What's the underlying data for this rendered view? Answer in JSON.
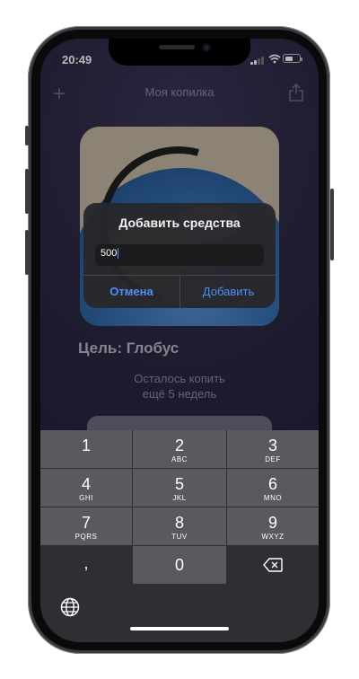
{
  "status_bar": {
    "time": "20:49"
  },
  "nav": {
    "title": "Моя копилка",
    "add_icon": "plus-icon",
    "share_icon": "share-icon"
  },
  "main": {
    "goal": "Цель: Глобус",
    "remaining_line1": "Осталось копить",
    "remaining_line2": "ещё 5 недель"
  },
  "alert": {
    "title": "Добавить средства",
    "input_value": "500",
    "cancel_label": "Отмена",
    "add_label": "Добавить"
  },
  "keyboard": {
    "keys": [
      {
        "num": "1",
        "letters": ""
      },
      {
        "num": "2",
        "letters": "ABC"
      },
      {
        "num": "3",
        "letters": "DEF"
      },
      {
        "num": "4",
        "letters": "GHI"
      },
      {
        "num": "5",
        "letters": "JKL"
      },
      {
        "num": "6",
        "letters": "MNO"
      },
      {
        "num": "7",
        "letters": "PQRS"
      },
      {
        "num": "8",
        "letters": "TUV"
      },
      {
        "num": "9",
        "letters": "WXYZ"
      },
      {
        "num": ",",
        "letters": ""
      },
      {
        "num": "0",
        "letters": ""
      }
    ],
    "delete_icon": "delete-backspace-icon",
    "globe_icon": "globe-icon"
  },
  "colors": {
    "accent": "#4f8ff7",
    "app_bg": "#2c2844",
    "keyboard_bg": "#2f2f33",
    "key_bg": "#595a5e"
  }
}
